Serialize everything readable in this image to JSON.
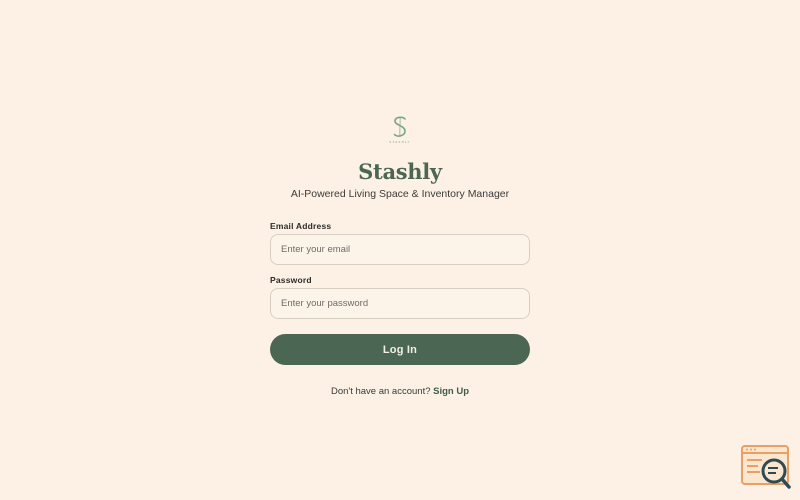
{
  "brand": {
    "logo_letter": "S",
    "logo_wordmark": "STASHLY",
    "name": "Stashly",
    "tagline": "AI-Powered Living Space & Inventory Manager"
  },
  "form": {
    "email": {
      "label": "Email Address",
      "placeholder": "Enter your email",
      "value": ""
    },
    "password": {
      "label": "Password",
      "placeholder": "Enter your password",
      "value": ""
    },
    "submit_label": "Log In"
  },
  "signup": {
    "prompt": "Don't have an account?",
    "link_label": "Sign Up"
  },
  "colors": {
    "background": "#fcf1e4",
    "primary": "#4b6653",
    "logo_accent": "#7aa585",
    "input_border": "#d8cfc4"
  },
  "icons": {
    "logo": "stashly-s-logo",
    "debug_widget": "browser-search-icon"
  }
}
